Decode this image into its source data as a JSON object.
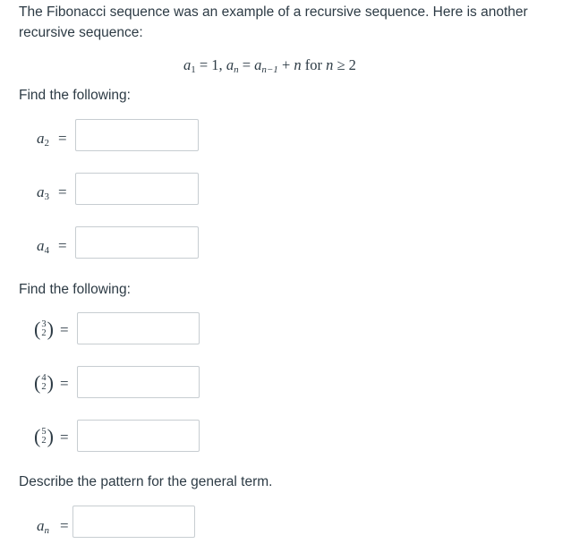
{
  "intro_text": "The Fibonacci sequence was an example of a recursive sequence. Here is another recursive sequence:",
  "recurrence": {
    "a": "a",
    "first_sub": "1",
    "first_eq": " = 1, ",
    "an_sub": "n",
    "eq2": " = ",
    "prev_sub": "n−1",
    "plus": " + ",
    "n": "n",
    "for_text": " for ",
    "geq": " ≥ 2"
  },
  "section1": {
    "heading": "Find the following:",
    "items": [
      {
        "var": "a",
        "sub": "2",
        "eq": "=",
        "value": ""
      },
      {
        "var": "a",
        "sub": "3",
        "eq": "=",
        "value": ""
      },
      {
        "var": "a",
        "sub": "4",
        "eq": "=",
        "value": ""
      }
    ]
  },
  "section2": {
    "heading": "Find the following:",
    "items": [
      {
        "top": "3",
        "bottom": "2",
        "eq": "=",
        "value": ""
      },
      {
        "top": "4",
        "bottom": "2",
        "eq": "=",
        "value": ""
      },
      {
        "top": "5",
        "bottom": "2",
        "eq": "=",
        "value": ""
      }
    ]
  },
  "section3": {
    "heading": "Describe the pattern for the general term.",
    "var": "a",
    "sub": "n",
    "eq": "=",
    "value": ""
  }
}
